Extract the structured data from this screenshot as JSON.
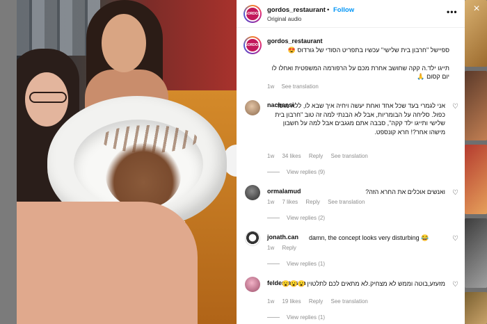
{
  "post": {
    "username": "gordos_restaurant",
    "follow_label": "Follow",
    "dot": "•",
    "audio": "Original audio",
    "more_label": "•••",
    "avatar_text": "GORDOS",
    "caption_line1": "ספיישל \"חרבון בית שלישי\" עכשיו בתפריט הסודי של גורדוס 😍",
    "caption_line2": "תייגו ילד.ה קקה שחושב אחרת מכם על הרפורמה המשפטית ואחלו לו יום קסום 🙏",
    "caption_time": "1w",
    "caption_see_translation": "See translation"
  },
  "comments": [
    {
      "username": "nachaesi",
      "text": "אני לגמרי בעד שכל אחד ואחת יעשה ויחיה איך שבא לו, ללא מוסר כפול. סליחה על הבומריות, אבל לא הבנתי למה זה טוב \"חרבון בית שלישי ותייגו ילד קקה\", סבבה אתם מגגבים אבל למה על חשבון מישהו אחר?! חרא קונספט.",
      "time": "1w",
      "likes": "34 likes",
      "reply": "Reply",
      "see_translation": "See translation",
      "view_replies": "View replies (9)"
    },
    {
      "username": "ormalamud",
      "text": "ואנשים אוכלים את החרא הזה?",
      "time": "1w",
      "likes": "7 likes",
      "reply": "Reply",
      "see_translation": "See translation",
      "view_replies": "View replies (2)"
    },
    {
      "username": "jonath.can",
      "text": "damn, the concept looks very disturbing 😂",
      "time": "1w",
      "reply": "Reply",
      "view_replies": "View replies (1)"
    },
    {
      "username": "feldersasson",
      "text": "מזעזע,בוטה וממש לא מצחיק.לא מתאים לכם לתלטוין 😮😮😮",
      "time": "1w",
      "likes": "19 likes",
      "reply": "Reply",
      "see_translation": "See translation",
      "view_replies": "View replies (1)"
    }
  ],
  "modal": {
    "close_label": "×"
  }
}
